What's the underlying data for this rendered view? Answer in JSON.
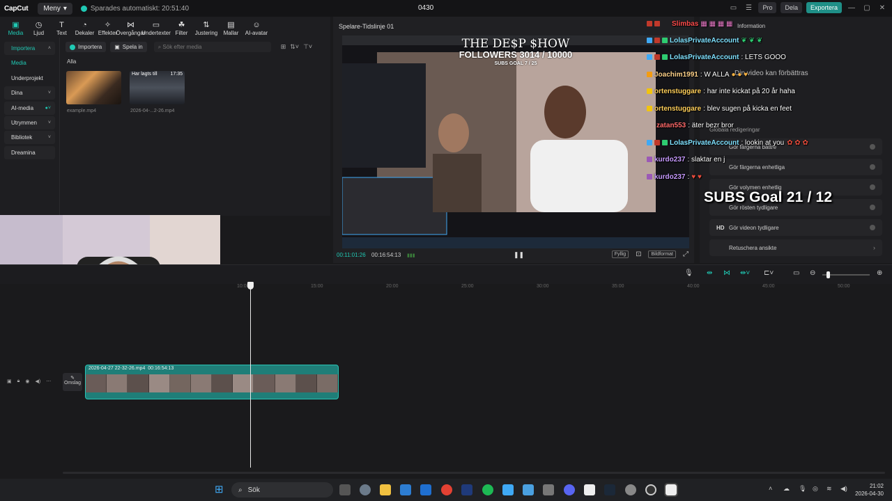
{
  "titlebar": {
    "logo": "CapCut",
    "menu_label": "Meny",
    "saved_text": "Sparades automatiskt: 20:51:40",
    "project_title": "0430",
    "pro_label": "Pro",
    "share_label": "Dela",
    "export_label": "Exportera"
  },
  "toolbar": {
    "items": [
      {
        "label": "Media",
        "icon": "media-icon"
      },
      {
        "label": "Ljud",
        "icon": "audio-icon"
      },
      {
        "label": "Text",
        "icon": "text-icon"
      },
      {
        "label": "Dekaler",
        "icon": "sticker-icon"
      },
      {
        "label": "Effekter",
        "icon": "effects-icon"
      },
      {
        "label": "Övergångar",
        "icon": "transitions-icon"
      },
      {
        "label": "Undertexter",
        "icon": "captions-icon"
      },
      {
        "label": "Filter",
        "icon": "filter-icon"
      },
      {
        "label": "Justering",
        "icon": "adjust-icon"
      },
      {
        "label": "Mallar",
        "icon": "templates-icon"
      },
      {
        "label": "AI-avatar",
        "icon": "avatar-icon"
      }
    ]
  },
  "leftnav": {
    "items": [
      {
        "label": "Importera"
      },
      {
        "label": "Media"
      },
      {
        "label": "Underprojekt"
      },
      {
        "label": "Dina"
      },
      {
        "label": "AI-media"
      },
      {
        "label": "Utrymmen"
      },
      {
        "label": "Bibliotek"
      },
      {
        "label": "Dreamina"
      }
    ]
  },
  "media": {
    "import_label": "Importera",
    "record_label": "Spela in",
    "search_placeholder": "Sök efter media",
    "filter_label": "Alla",
    "thumbs": [
      {
        "name": "example.mp4",
        "badge": ""
      },
      {
        "name": "2026-04-...2-26.mp4",
        "badge": "Har lagts till",
        "duration": "17:35"
      }
    ]
  },
  "player": {
    "title": "Spelare-Tidslinje 01",
    "timecode_current": "00:11:01:26",
    "timecode_total": "00:16:54:13",
    "fit_label": "Fyllig",
    "ratio_label": "Bildformat",
    "stream_title": "THE DE$P $HOW",
    "followers_line": "FOLLOWERS 3014 / 10000",
    "subs_small": "SUBS GOAL 7 / 25"
  },
  "rightpanel": {
    "ghost_info": "Information",
    "ghost_improve": "Din video kan förbättras",
    "ghost_bulk": "Globala redigeringar",
    "rows": [
      {
        "label": "Gör färgerna bättre",
        "prefix": ""
      },
      {
        "label": "Gör färgerna enhetliga",
        "prefix": ""
      },
      {
        "label": "Gör volymen enhetlig",
        "prefix": ""
      },
      {
        "label": "Gör rösten tydligare",
        "prefix": ""
      },
      {
        "label": "Gör videon tydligare",
        "prefix": "HD"
      },
      {
        "label": "Retuschera ansikte",
        "prefix": ""
      }
    ]
  },
  "chat": {
    "lines": [
      {
        "user": "Slimbas",
        "msg": "",
        "color": "#ff4d4d"
      },
      {
        "user": "LolasPrivateAccount",
        "msg": "",
        "color": "#7fe1ff"
      },
      {
        "user": "LolasPrivateAccount",
        "msg": ": LETS GOOO",
        "color": "#7fe1ff"
      },
      {
        "user": "Joachim1991",
        "msg": ": W ALLA",
        "color": "#ffd28a"
      },
      {
        "user": "ortenstuggare",
        "msg": ": har inte kickat på 20 år haha",
        "color": "#ffcf5a"
      },
      {
        "user": "ortenstuggare",
        "msg": ": blev sugen på kicka en feet",
        "color": "#ffcf5a"
      },
      {
        "user": "zatan553",
        "msg": ": äter bezr bror",
        "color": "#ff6a6a"
      },
      {
        "user": "LolasPrivateAccount",
        "msg": ": lookin at you",
        "color": "#7fe1ff"
      },
      {
        "user": "kurdo237",
        "msg": ": slaktar en j",
        "color": "#c89bff"
      },
      {
        "user": "kurdo237",
        "msg": ":",
        "color": "#c89bff"
      }
    ],
    "subs_goal": "SUBS Goal 21 / 12"
  },
  "timeline": {
    "ruler": [
      "10:00",
      "15:00",
      "20:00",
      "25:00",
      "30:00",
      "35:00",
      "40:00",
      "45:00",
      "50:00"
    ],
    "cover_label": "Omslag",
    "clip_name": "2026-04-27 22-32-26.mp4",
    "clip_duration": "00:16:54:13"
  },
  "taskbar": {
    "search_label": "Sök",
    "time": "21:02",
    "date": "2026-04-30"
  }
}
